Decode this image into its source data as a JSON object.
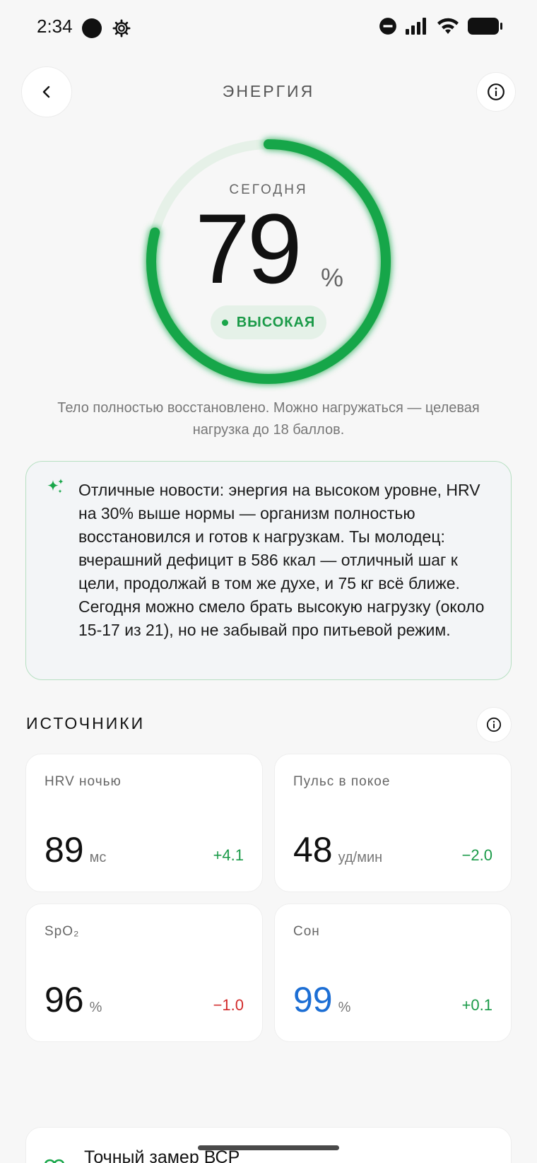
{
  "status_bar": {
    "time": "2:34",
    "icons": [
      "black-dot-icon",
      "settings-gear-icon",
      "do-not-disturb-icon",
      "signal-icon",
      "wifi-icon",
      "battery-icon"
    ]
  },
  "header": {
    "title": "ЭНЕРГИЯ",
    "back_icon": "chevron-left-icon",
    "info_icon": "info-icon"
  },
  "gauge": {
    "label": "СЕГОДНЯ",
    "value": "79",
    "unit": "%",
    "fill_fraction": 0.79,
    "level_label": "ВЫСОКАЯ",
    "color": "#19a64a",
    "track_color": "#e6f1e8"
  },
  "summary": "Тело полностью восстановлено. Можно нагружаться — целевая нагрузка до 18 баллов.",
  "ai_card": {
    "icon": "sparkle-icon",
    "text": "Отличные новости: энергия на высоком уровне, HRV на 30% выше нормы — организм полностью восстановился и готов к нагрузкам. Ты молодец: вчерашний дефицит в 586 ккал — отличный шаг к цели, продолжай в том же духе, и 75 кг всё ближе. Сегодня можно смело брать высокую нагрузку (около 15-17 из 21), но не забывай про питьевой режим."
  },
  "sources": {
    "title": "ИСТОЧНИКИ",
    "info_icon": "info-icon",
    "metrics": [
      {
        "label": "HRV ночью",
        "value": "89",
        "unit": "мс",
        "delta": "+4.1",
        "delta_color": "green",
        "value_color": "default"
      },
      {
        "label": "Пульс в покое",
        "value": "48",
        "unit": "уд/мин",
        "delta": "−2.0",
        "delta_color": "green",
        "value_color": "default"
      },
      {
        "label": "SpO₂",
        "value": "96",
        "unit": "%",
        "delta": "−1.0",
        "delta_color": "red",
        "value_color": "default"
      },
      {
        "label": "Сон",
        "value": "99",
        "unit": "%",
        "delta": "+0.1",
        "delta_color": "green",
        "value_color": "blue"
      }
    ]
  },
  "bottom_card": {
    "icon": "heart-icon",
    "title": "Точный замер ВСР"
  },
  "colors": {
    "accent_green": "#19a64a",
    "delta_red": "#d22b2b",
    "value_blue": "#1c6ed4"
  }
}
